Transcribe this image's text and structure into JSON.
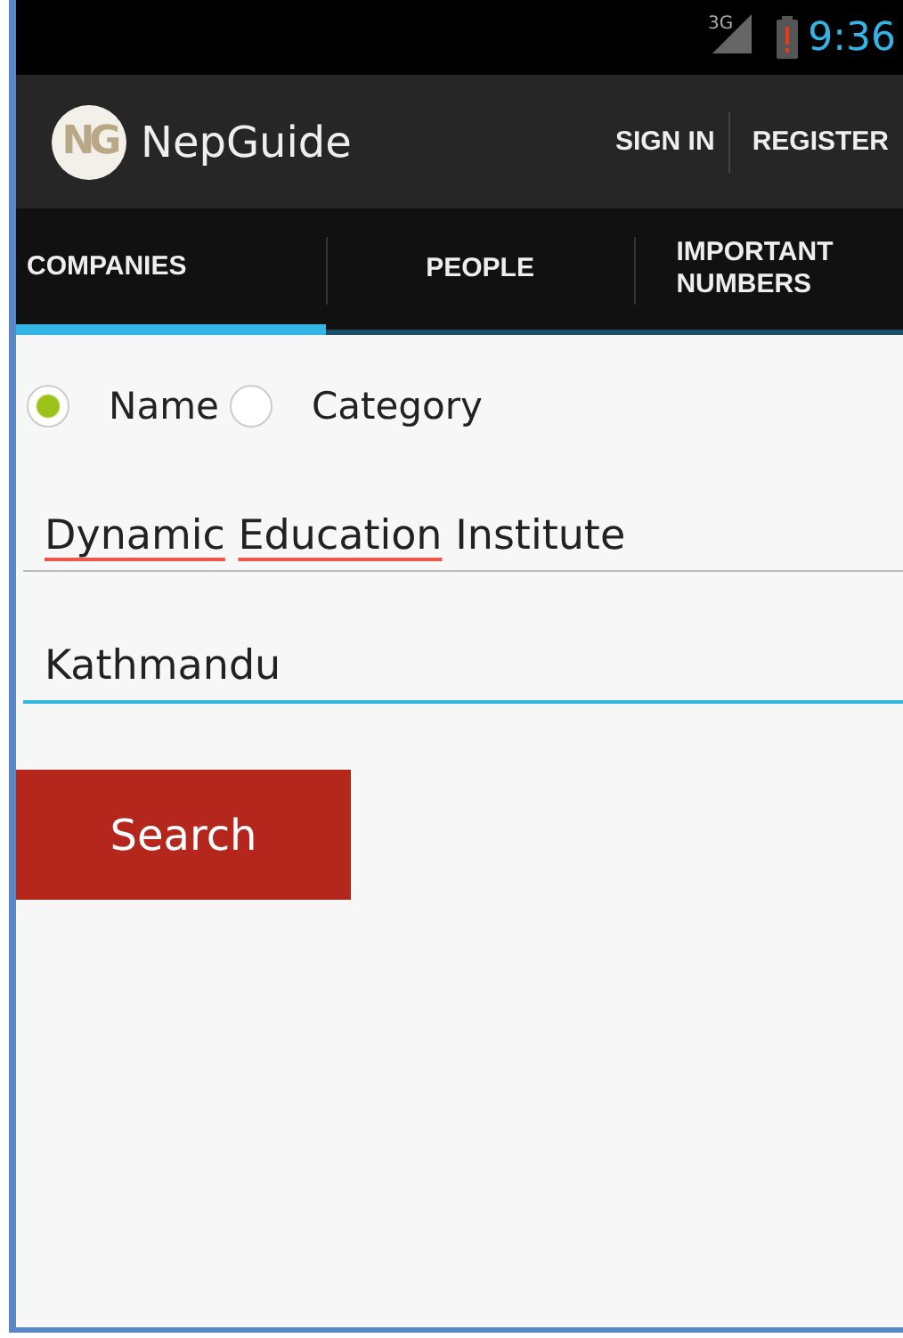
{
  "status_bar": {
    "network": "3G",
    "time": "9:36",
    "battery_alert": true
  },
  "action_bar": {
    "logo": "NG",
    "title": "NepGuide",
    "actions": [
      "SIGN IN",
      "REGISTER"
    ]
  },
  "tabs": [
    {
      "label": "COMPANIES",
      "selected": true
    },
    {
      "label": "PEOPLE",
      "selected": false
    },
    {
      "label": "IMPORTANT NUMBERS",
      "selected": false
    }
  ],
  "search_by": [
    {
      "label": "Name",
      "selected": true
    },
    {
      "label": "Category",
      "selected": false
    }
  ],
  "fields": [
    {
      "focused": false,
      "words": [
        {
          "text": "Dynamic",
          "misspelled": true
        },
        {
          "text": "Education",
          "misspelled": true
        },
        {
          "text": "Institute",
          "misspelled": false
        }
      ]
    },
    {
      "focused": true,
      "words": [
        {
          "text": "Kathmandu",
          "misspelled": false
        }
      ]
    }
  ],
  "search_button": "Search"
}
